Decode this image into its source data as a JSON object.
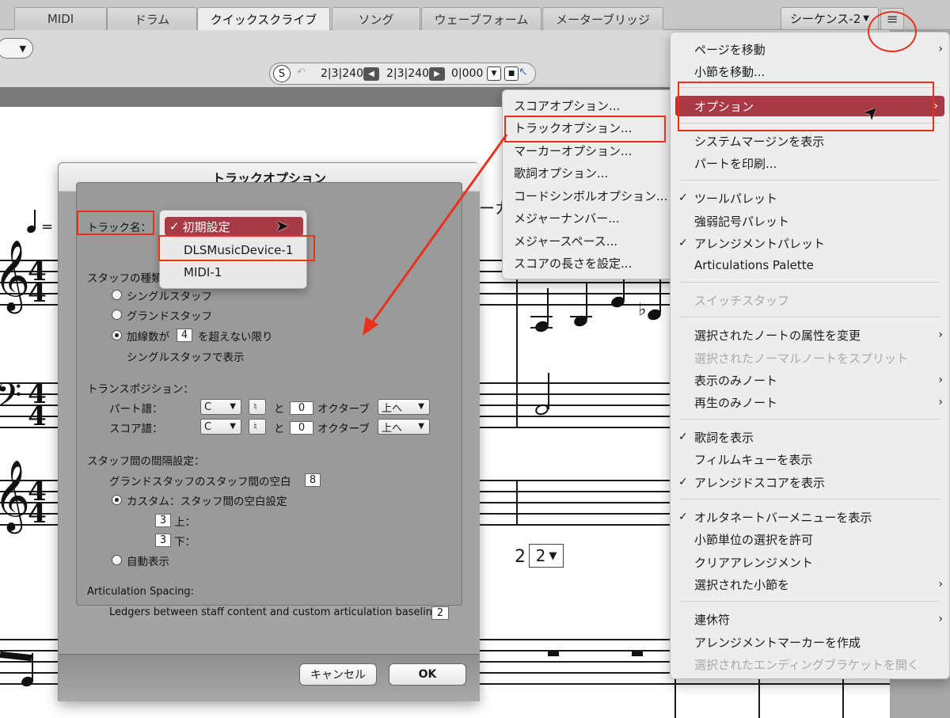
{
  "tabs": [
    "MIDI",
    "ドラム",
    "クイックスクライブ",
    "ソング",
    "ウェーブフォーム",
    "メーターブリッジ"
  ],
  "active_tab": "クイックスクライブ",
  "sequence_selector": "シーケンス-2",
  "transport": {
    "s_label": "S",
    "pos1": "2|3|240",
    "pos2": "2|3|240",
    "pos3": "0|000"
  },
  "score": {
    "tempo_eq": "=",
    "time_sig_top": "4",
    "time_sig_bottom": "4",
    "measure_num": "2",
    "measure_select": "2",
    "cut_text": "ーカ"
  },
  "dialog": {
    "title": "トラックオプション",
    "track_name_label": "トラック名：",
    "staff_type_label": "スタッフの種類",
    "single_staff": "シングルスタッフ",
    "grand_staff": "グランドスタッフ",
    "ledger_prefix": "加線数が",
    "ledger_value": "4",
    "ledger_suffix": "を超えない限り",
    "ledger_line2": "シングルスタッフで表示",
    "transposition_label": "トランスポジション：",
    "part_label": "パート譜：",
    "score_label": "スコア譜：",
    "part_key": "C",
    "score_key": "C",
    "and_label": "と",
    "part_octave": "0",
    "score_octave": "0",
    "octave_label": "オクターブ",
    "part_direction": "上へ",
    "score_direction": "上へ",
    "spacing_label": "スタッフ間の間隔設定：",
    "grand_spacing_label": "グランドスタッフのスタッフ間の空白",
    "grand_spacing_value": "8",
    "custom_label": "カスタム：スタッフ間の空白設定",
    "above_value": "3",
    "above_label": "上：",
    "below_value": "3",
    "below_label": "下：",
    "auto_label": "自動表示",
    "artic_label": "Articulation Spacing:",
    "ledger_artic_label": "Ledgers between staff content and custom articulation baseline:",
    "ledger_artic_value": "2",
    "cancel": "キャンセル",
    "ok": "OK"
  },
  "track_dropdown": {
    "items": [
      "初期設定",
      "DLSMusicDevice-1",
      "MIDI-1"
    ],
    "selected": "初期設定"
  },
  "submenu": {
    "items": [
      "スコアオプション...",
      "トラックオプション...",
      "マーカーオプション...",
      "歌詞オプション...",
      "コードシンボルオプション...",
      "メジャーナンバー...",
      "メジャースペース...",
      "スコアの長さを設定..."
    ]
  },
  "main_menu": {
    "items": [
      {
        "label": "ページを移動",
        "check": "",
        "sub": "›",
        "disabled": false
      },
      {
        "label": "小節を移動...",
        "check": "",
        "sub": "",
        "disabled": false
      },
      {
        "label": "オプション",
        "check": "",
        "sub": "›",
        "disabled": false,
        "highlight": true
      },
      {
        "label": "システムマージンを表示",
        "check": "",
        "sub": "",
        "disabled": false
      },
      {
        "label": "パートを印刷...",
        "check": "",
        "sub": "",
        "disabled": false
      },
      {
        "label": "ツールパレット",
        "check": "✓",
        "sub": "",
        "disabled": false
      },
      {
        "label": "強弱記号パレット",
        "check": "",
        "sub": "",
        "disabled": false
      },
      {
        "label": "アレンジメントパレット",
        "check": "✓",
        "sub": "",
        "disabled": false
      },
      {
        "label": "Articulations Palette",
        "check": "",
        "sub": "",
        "disabled": false
      },
      {
        "label": "スイッチスタッフ",
        "check": "",
        "sub": "",
        "disabled": true
      },
      {
        "label": "選択されたノートの属性を変更",
        "check": "",
        "sub": "›",
        "disabled": false
      },
      {
        "label": "選択されたノーマルノートをスプリット",
        "check": "",
        "sub": "",
        "disabled": true
      },
      {
        "label": "表示のみノート",
        "check": "",
        "sub": "›",
        "disabled": false
      },
      {
        "label": "再生のみノート",
        "check": "",
        "sub": "›",
        "disabled": false
      },
      {
        "label": "歌詞を表示",
        "check": "✓",
        "sub": "",
        "disabled": false
      },
      {
        "label": "フィルムキューを表示",
        "check": "",
        "sub": "",
        "disabled": false
      },
      {
        "label": "アレンジドスコアを表示",
        "check": "✓",
        "sub": "",
        "disabled": false
      },
      {
        "label": "オルタネートバーメニューを表示",
        "check": "✓",
        "sub": "",
        "disabled": false
      },
      {
        "label": "小節単位の選択を許可",
        "check": "",
        "sub": "",
        "disabled": false
      },
      {
        "label": "クリアアレンジメント",
        "check": "",
        "sub": "",
        "disabled": false
      },
      {
        "label": "選択された小節を",
        "check": "",
        "sub": "›",
        "disabled": false
      },
      {
        "label": "連休符",
        "check": "",
        "sub": "›",
        "disabled": false
      },
      {
        "label": "アレンジメントマーカーを作成",
        "check": "",
        "sub": "",
        "disabled": false
      },
      {
        "label": "選択されたエンディングブラケットを開く",
        "check": "",
        "sub": "",
        "disabled": true
      }
    ]
  },
  "colors": {
    "highlight": "#a83a45",
    "annotation": "#e8321e",
    "dialog_bg": "#a3a3a3"
  }
}
